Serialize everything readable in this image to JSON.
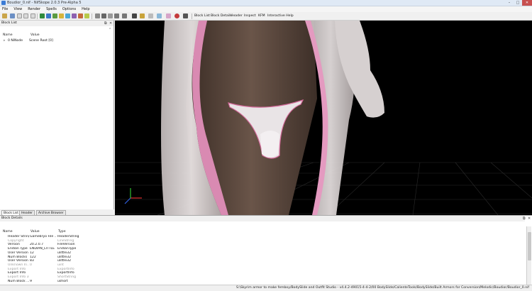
{
  "window": {
    "title": "Boudior_0.nif - NifSkope 2.0.3 Pre-Alpha 5",
    "controls": {
      "minimize": "–",
      "maximize": "□",
      "close": "✕"
    }
  },
  "menu": [
    "File",
    "View",
    "Render",
    "Spells",
    "Options",
    "Help"
  ],
  "toolbar": {
    "buttons": [
      "Block List",
      "Block Details",
      "Header",
      "Inspect",
      "KFM",
      "Interactive Help"
    ]
  },
  "block_list": {
    "title": "Block List",
    "columns": [
      "Name",
      "Value"
    ],
    "rows": [
      {
        "expander": "▹",
        "name": "0 NiNode",
        "value": "Scene Root [0]"
      }
    ],
    "tabs": [
      "Block List",
      "Header",
      "Archive Browser"
    ]
  },
  "block_details": {
    "title": "Block Details",
    "columns": [
      "Name",
      "Value",
      "Type"
    ],
    "rows": [
      {
        "name": "Header String",
        "value": "Gamebryo File ...",
        "type": "HeaderString",
        "dim": false
      },
      {
        "name": "Copyright",
        "value": "",
        "type": "LineString",
        "dim": true
      },
      {
        "name": "Version",
        "value": "20.2.0.7",
        "type": "FileVersion",
        "dim": false
      },
      {
        "name": "Endian Type",
        "value": "ENDIAN_LITTLE",
        "type": "EndianType",
        "dim": false
      },
      {
        "name": "User Version",
        "value": "12",
        "type": "ulittle32",
        "dim": false
      },
      {
        "name": "Num Blocks",
        "value": "122",
        "type": "ulittle32",
        "dim": false
      },
      {
        "name": "User Version 2",
        "value": "83",
        "type": "ulittle32",
        "dim": false
      },
      {
        "name": "Unknown In...",
        "value": "0",
        "type": "uint",
        "dim": true
      },
      {
        "name": "Export Info",
        "value": "",
        "type": "ExportInfo",
        "dim": true
      },
      {
        "name": "Export Info",
        "value": "",
        "type": "ExportInfo",
        "dim": false
      },
      {
        "name": "Export Info 3",
        "value": "",
        "type": "ShortString",
        "dim": true
      },
      {
        "name": "Num Block ...",
        "value": "9",
        "type": "ushort",
        "dim": false
      }
    ]
  },
  "status": {
    "message": "S:\\Skyrim armor to make femboy/BodySlide and Outfit Studio - v4.4.2-49015-4-4-2/00 BodySlide/CalienteTools/BodySlide/Built Armors for Conversion/Melodic/Boudior/Boudior_0.nif"
  }
}
